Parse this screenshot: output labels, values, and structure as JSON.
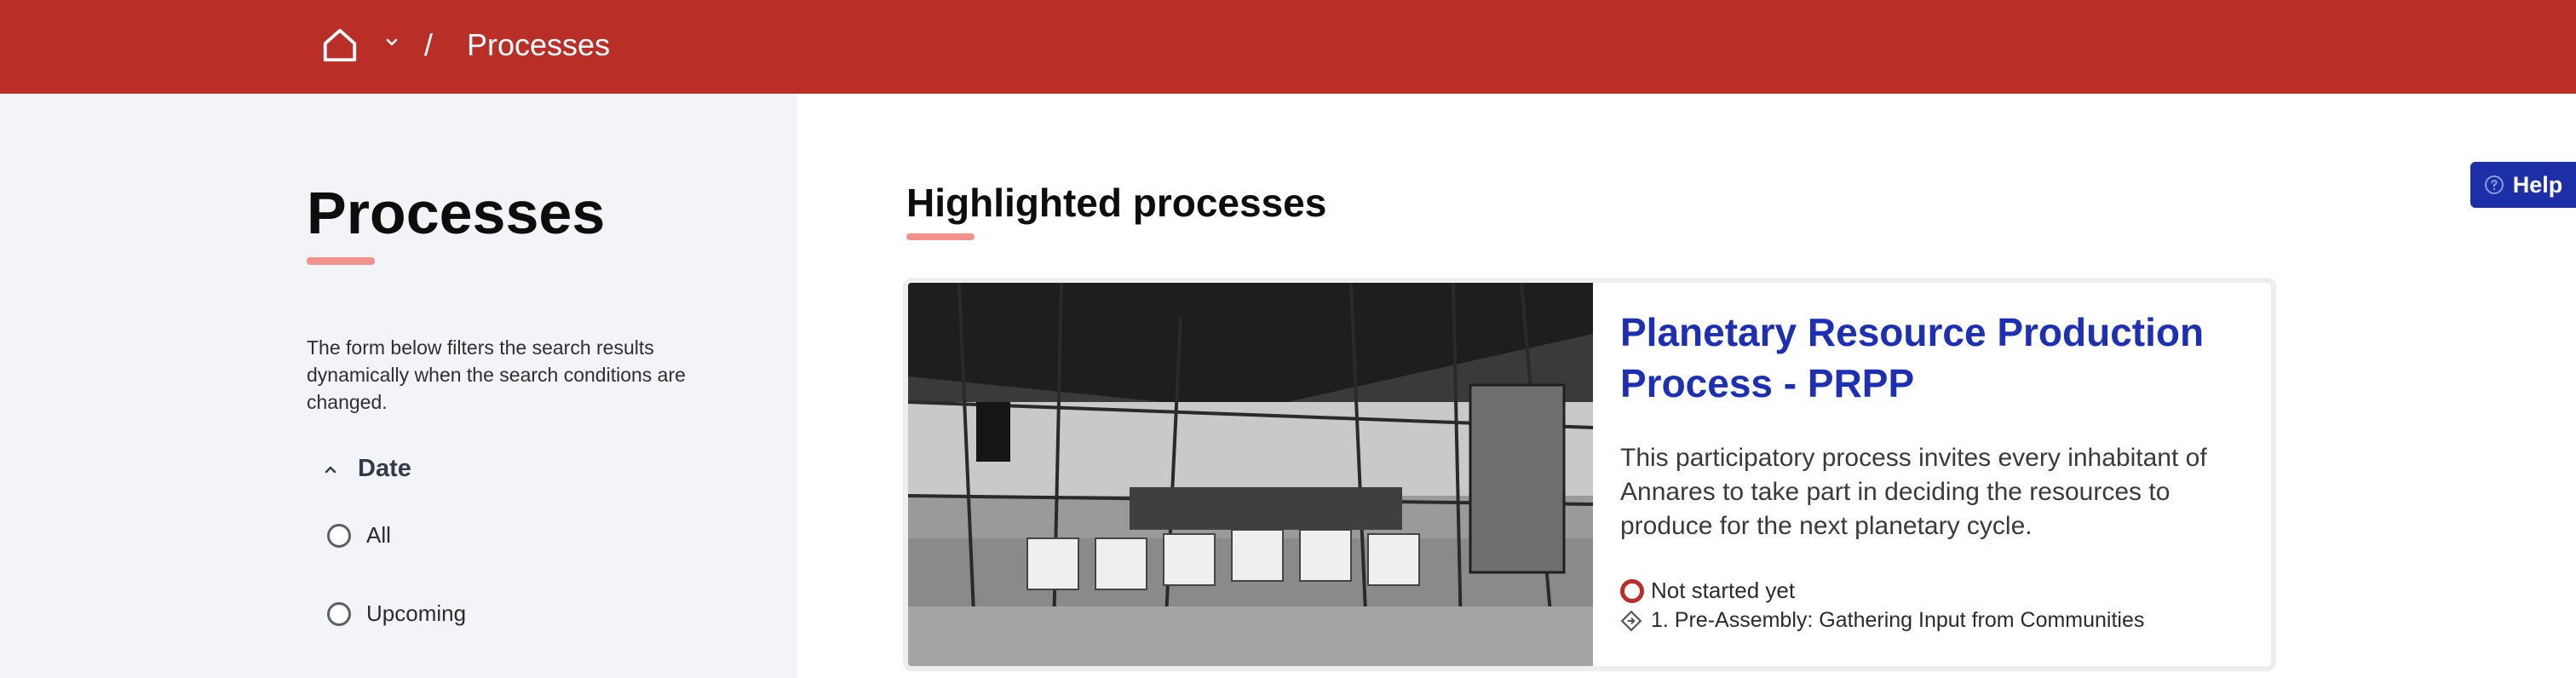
{
  "header": {
    "breadcrumb_separator": "/",
    "breadcrumb_current": "Processes",
    "bar_color": "#b92e27"
  },
  "sidebar": {
    "title": "Processes",
    "filter_description": "The form below filters the search results dynamically when the search conditions are changed.",
    "date_filter": {
      "label": "Date",
      "options": [
        "All",
        "Upcoming"
      ]
    }
  },
  "main": {
    "section_title": "Highlighted processes",
    "help_label": "Help",
    "card": {
      "title": "Planetary Resource Production Process - PRPP",
      "description": "This participatory process invites every inhabitant of Annares to take part in deciding the resources to produce for the next planetary cycle.",
      "status": "Not started yet",
      "step": "1. Pre-Assembly: Gathering Input from Communities"
    }
  },
  "icons": [
    "home-icon",
    "chevron-down-icon",
    "chevron-up-icon",
    "help-circle-icon",
    "status-ring-icon",
    "step-diamond-icon"
  ],
  "colors": {
    "accent": "#b92e27",
    "link": "#1d2fb5",
    "help_button": "#1d2fa6",
    "underline": "#f1928c"
  }
}
